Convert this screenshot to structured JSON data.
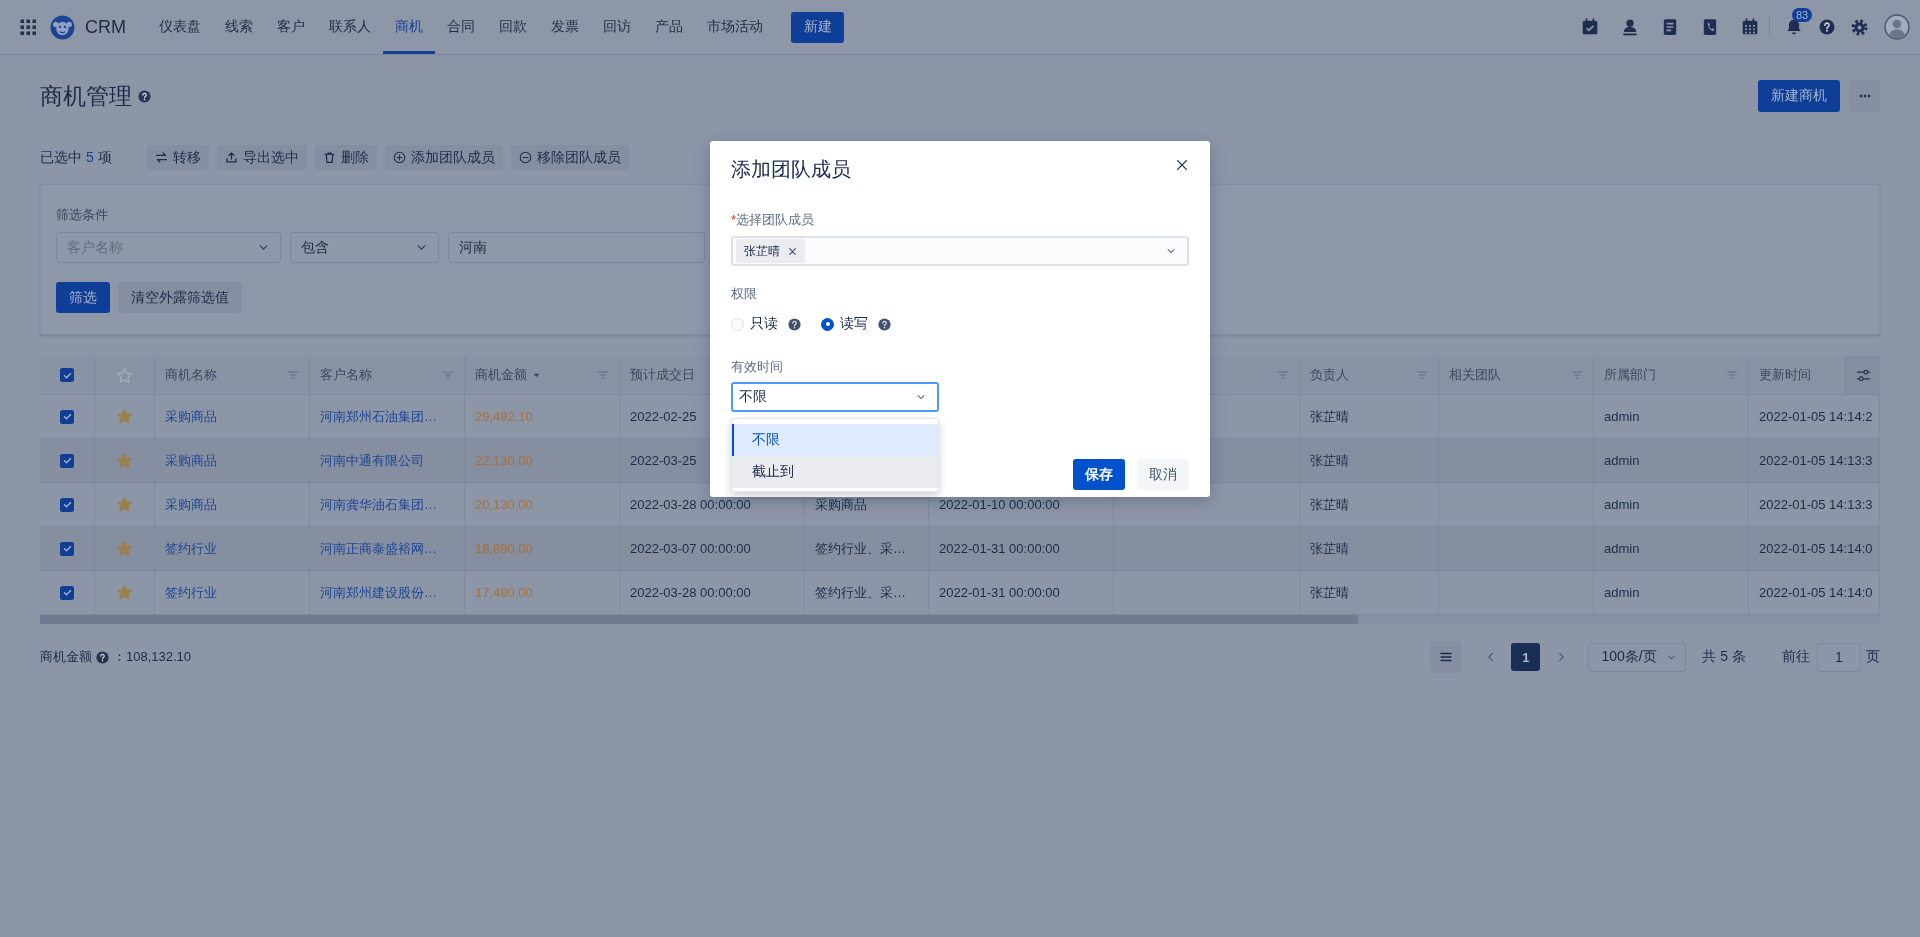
{
  "nav": {
    "logo_text": "CRM",
    "items": [
      {
        "label": "仪表盘",
        "selected": false
      },
      {
        "label": "线索",
        "selected": false
      },
      {
        "label": "客户",
        "selected": false
      },
      {
        "label": "联系人",
        "selected": false
      },
      {
        "label": "商机",
        "selected": true
      },
      {
        "label": "合同",
        "selected": false
      },
      {
        "label": "回款",
        "selected": false
      },
      {
        "label": "发票",
        "selected": false
      },
      {
        "label": "回访",
        "selected": false
      },
      {
        "label": "产品",
        "selected": false
      },
      {
        "label": "市场活动",
        "selected": false
      }
    ],
    "new_button": "新建",
    "notification_count": "83"
  },
  "page": {
    "title": "商机管理",
    "new_button": "新建商机"
  },
  "selection": {
    "prefix": "已选中",
    "count": "5",
    "suffix": "项"
  },
  "bulk_actions": [
    {
      "label": "转移"
    },
    {
      "label": "导出选中"
    },
    {
      "label": "删除"
    },
    {
      "label": "添加团队成员"
    },
    {
      "label": "移除团队成员"
    }
  ],
  "filter": {
    "label": "筛选条件",
    "field": {
      "placeholder": "客户名称"
    },
    "operator": {
      "value": "包含"
    },
    "value": {
      "value": "河南"
    },
    "buttons": [
      {
        "label": "筛选",
        "kind": "primary"
      },
      {
        "label": "清空外露筛选值",
        "kind": "secondary"
      }
    ]
  },
  "table": {
    "all_checked": true,
    "columns": [
      {
        "label": "商机名称",
        "filter": true,
        "sort": false
      },
      {
        "label": "客户名称",
        "filter": true,
        "sort": false
      },
      {
        "label": "商机金额",
        "filter": true,
        "sort": true
      },
      {
        "label": "预计成交日"
      },
      null,
      null,
      {
        "filter": true
      },
      {
        "label": "负责人",
        "filter": true,
        "sort": false
      },
      {
        "label": "相关团队",
        "filter": true,
        "sort": false
      },
      {
        "label": "所属部门",
        "filter": true,
        "sort": false
      },
      {
        "label": "更新时间",
        "filter": false,
        "sort": false
      }
    ],
    "rows": [
      {
        "checked": true,
        "starred": true,
        "name": "采购商品",
        "customer": "河南郑州石油集团…",
        "amount": "29,492.10",
        "close_date": "2022-02-25",
        "owner": "张芷晴",
        "department": "admin",
        "updated": "2022-01-05 14:14:2"
      },
      {
        "checked": true,
        "starred": true,
        "name": "采购商品",
        "customer": "河南中通有限公司",
        "amount": "22,130.00",
        "close_date": "2022-03-25",
        "owner": "张芷晴",
        "department": "admin",
        "updated": "2022-01-05 14:13:3"
      },
      {
        "checked": true,
        "starred": true,
        "name": "采购商品",
        "customer": "河南龚华油石集团…",
        "amount": "20,130.00",
        "close_date": "2022-03-28 00:00:00",
        "column_7": "采购商品",
        "column_8": "2022-01-10 00:00:00",
        "owner": "张芷晴",
        "department": "admin",
        "updated": "2022-01-05 14:13:3"
      },
      {
        "checked": true,
        "starred": true,
        "name": "签约行业",
        "customer": "河南正商泰盛裕网…",
        "amount": "18,890.00",
        "close_date": "2022-03-07 00:00:00",
        "column_7": "签约行业、采…",
        "column_8": "2022-01-31 00:00:00",
        "owner": "张芷晴",
        "department": "admin",
        "updated": "2022-01-05 14:14:0"
      },
      {
        "checked": true,
        "starred": true,
        "name": "签约行业",
        "customer": "河南郑州建设股份…",
        "amount": "17,490.00",
        "close_date": "2022-03-28 00:00:00",
        "column_7": "签约行业、采…",
        "column_8": "2022-01-31 00:00:00",
        "owner": "张芷晴",
        "department": "admin",
        "updated": "2022-01-05 14:14:0"
      }
    ]
  },
  "summary": {
    "label": "商机金额",
    "value": "：108,132.10"
  },
  "pagination": {
    "pages": [
      {
        "label": "1",
        "selected": true
      }
    ],
    "page_size": "100条/页",
    "total": "共 5 条",
    "goto_label": "前往",
    "goto_value": "1",
    "goto_suffix": "页"
  },
  "dialog": {
    "title": "添加团队成员",
    "member_field": {
      "required_mark": "*",
      "label": "选择团队成员",
      "tags": [
        {
          "label": "张芷晴"
        }
      ]
    },
    "permission": {
      "label": "权限",
      "options": [
        {
          "label": "只读",
          "selected": false
        },
        {
          "label": "读写",
          "selected": true
        }
      ]
    },
    "valid_time": {
      "label": "有效时间",
      "value": "不限",
      "expanded": true,
      "options": [
        {
          "label": "不限",
          "selected": true
        },
        {
          "label": "截止到",
          "selected": false,
          "hovered": true
        }
      ]
    },
    "buttons": [
      {
        "label": "保存",
        "kind": "primary"
      },
      {
        "label": "取消",
        "kind": "secondary"
      }
    ]
  }
}
